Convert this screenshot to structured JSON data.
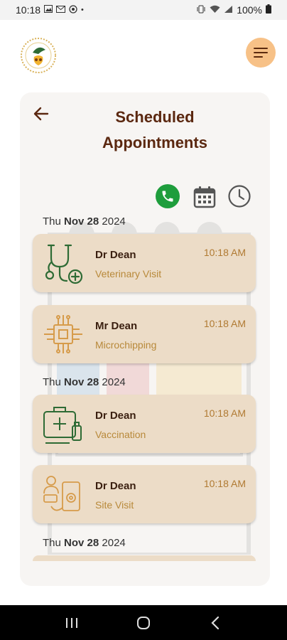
{
  "status_bar": {
    "time": "10:18",
    "battery": "100%",
    "left_icons": [
      "gallery-icon",
      "gmail-icon",
      "whatsapp-icon",
      "dot-icon"
    ],
    "right_icons": [
      "vibrate-icon",
      "wifi-icon",
      "signal-icon",
      "battery-icon"
    ]
  },
  "header": {
    "logo_icon": "app-logo-icon",
    "menu_icon": "hamburger-menu-icon",
    "menu_color": "#f7c187"
  },
  "page": {
    "title": "Scheduled Appointments",
    "back_icon": "back-arrow-icon"
  },
  "actions": [
    {
      "icon": "phone-icon",
      "color": "#1e9d3c"
    },
    {
      "icon": "calendar-icon"
    },
    {
      "icon": "clock-icon"
    }
  ],
  "groups": [
    {
      "date_prefix": "Thu",
      "date_bold": "Nov 28",
      "year": "2024",
      "appointments": [
        {
          "name": "Dr Dean",
          "type": "Veterinary Visit",
          "time": "10:18 AM",
          "icon": "stethoscope-icon",
          "icon_color": "#2e6b35"
        },
        {
          "name": "Mr Dean",
          "type": "Microchipping",
          "time": "10:18 AM",
          "icon": "microchip-icon",
          "icon_color": "#d69b4a"
        }
      ]
    },
    {
      "date_prefix": "Thu",
      "date_bold": "Nov 28",
      "year": "2024",
      "appointments": [
        {
          "name": "Dr Dean",
          "type": "Vaccination",
          "time": "10:18 AM",
          "icon": "medical-kit-icon",
          "icon_color": "#2e6b35"
        },
        {
          "name": "Dr Dean",
          "type": "Site Visit",
          "time": "10:18 AM",
          "icon": "site-visit-icon",
          "icon_color": "#d69b4a"
        }
      ]
    },
    {
      "date_prefix": "Thu",
      "date_bold": "Nov 28",
      "year": "2024",
      "appointments": []
    }
  ],
  "nav_bar": {
    "buttons": [
      "recents-icon",
      "home-icon",
      "back-nav-icon"
    ]
  }
}
